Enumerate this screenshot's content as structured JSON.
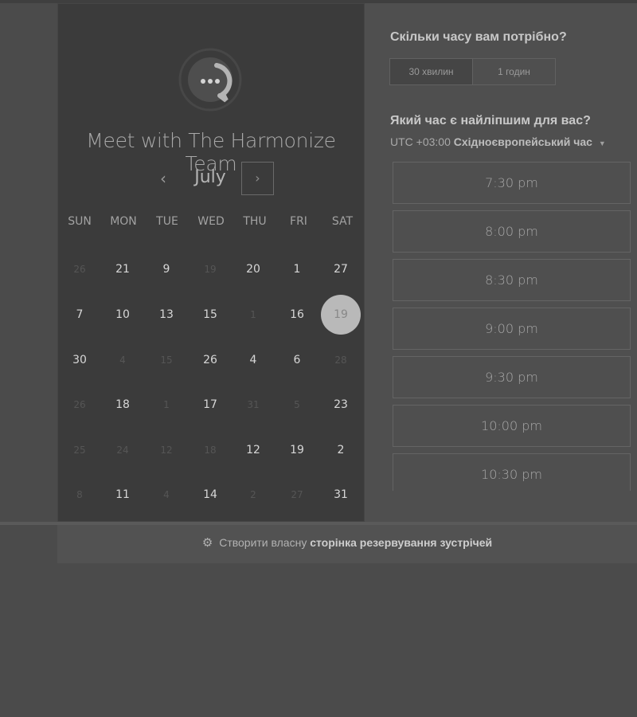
{
  "calendar": {
    "team_title": "Meet with The Harmonize Team",
    "month": "July",
    "prev_icon": "chevron-left",
    "next_icon": "chevron-right",
    "weekdays": [
      "SUN",
      "MON",
      "TUE",
      "WED",
      "THU",
      "FRI",
      "SAT"
    ],
    "weeks": [
      [
        {
          "d": "26",
          "m": true
        },
        {
          "d": "21"
        },
        {
          "d": "9"
        },
        {
          "d": "19",
          "m": true
        },
        {
          "d": "20"
        },
        {
          "d": "1"
        },
        {
          "d": "27"
        }
      ],
      [
        {
          "d": "7"
        },
        {
          "d": "10"
        },
        {
          "d": "13"
        },
        {
          "d": "15"
        },
        {
          "d": "1",
          "m": true
        },
        {
          "d": "16"
        },
        {
          "d": "19",
          "s": true
        }
      ],
      [
        {
          "d": "30"
        },
        {
          "d": "4",
          "m": true
        },
        {
          "d": "15",
          "m": true
        },
        {
          "d": "26"
        },
        {
          "d": "4"
        },
        {
          "d": "6"
        },
        {
          "d": "28",
          "m": true
        }
      ],
      [
        {
          "d": "26",
          "m": true
        },
        {
          "d": "18"
        },
        {
          "d": "1",
          "m": true
        },
        {
          "d": "17"
        },
        {
          "d": "31",
          "m": true
        },
        {
          "d": "5",
          "m": true
        },
        {
          "d": "23"
        }
      ],
      [
        {
          "d": "25",
          "m": true
        },
        {
          "d": "24",
          "m": true
        },
        {
          "d": "12",
          "m": true
        },
        {
          "d": "18",
          "m": true
        },
        {
          "d": "12"
        },
        {
          "d": "19"
        },
        {
          "d": "2"
        }
      ],
      [
        {
          "d": "8",
          "m": true
        },
        {
          "d": "11"
        },
        {
          "d": "4",
          "m": true
        },
        {
          "d": "14"
        },
        {
          "d": "2",
          "m": true
        },
        {
          "d": "27",
          "m": true
        },
        {
          "d": "31"
        }
      ]
    ]
  },
  "duration": {
    "title": "Скільки часу вам потрібно?",
    "options": [
      "30 хвилин",
      "1 годин"
    ],
    "selected": "30 хвилин"
  },
  "time": {
    "title": "Який час є найліпшим для вас?",
    "timezone_offset": "UTC +03:00",
    "timezone_name": "Східноєвропейський час",
    "slots": [
      "7:30 pm",
      "8:00 pm",
      "8:30 pm",
      "9:00 pm",
      "9:30 pm",
      "10:00 pm",
      "10:30 pm"
    ]
  },
  "footer": {
    "prefix": "Створити власну",
    "link": "сторінка резервування зустрічей"
  }
}
